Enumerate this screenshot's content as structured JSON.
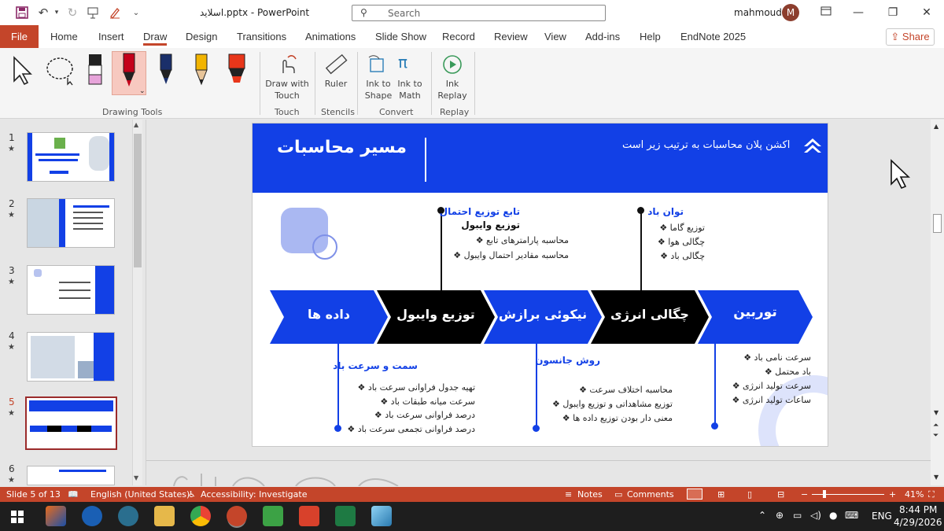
{
  "titlebar": {
    "doc_title": "اسلاید.pptx  -  PowerPoint",
    "search_placeholder": "Search",
    "user_name": "mahmoud",
    "user_initial": "M"
  },
  "tabs": [
    "Home",
    "Insert",
    "Draw",
    "Design",
    "Transitions",
    "Animations",
    "Slide Show",
    "Record",
    "Review",
    "View",
    "Add-ins",
    "Help",
    "EndNote 2025"
  ],
  "file_tab": "File",
  "active_tab": "Draw",
  "share_label": "Share",
  "ribbon": {
    "groups": {
      "drawing_tools": "Drawing Tools",
      "touch": "Touch",
      "stencils": "Stencils",
      "convert": "Convert",
      "replay": "Replay"
    },
    "buttons": {
      "draw_with_touch_1": "Draw with",
      "draw_with_touch_2": "Touch",
      "ruler": "Ruler",
      "ink_to_shape_1": "Ink to",
      "ink_to_shape_2": "Shape",
      "ink_to_math_1": "Ink to",
      "ink_to_math_2": "Math",
      "ink_replay_1": "Ink",
      "ink_replay_2": "Replay"
    }
  },
  "thumbnails": [
    {
      "num": "1",
      "star": "★"
    },
    {
      "num": "2",
      "star": "★"
    },
    {
      "num": "3",
      "star": "★"
    },
    {
      "num": "4",
      "star": "★"
    },
    {
      "num": "5",
      "star": "★"
    },
    {
      "num": "6",
      "star": "★"
    }
  ],
  "slide": {
    "title": "مسیر محاسبات",
    "subtitle": "اکشن پلان محاسبات به ترتیب زیر است",
    "arrows": [
      "توربین",
      "چگالی انرژی",
      "نیکوئی برازش",
      "توزیع وایبول",
      "داده ها"
    ],
    "top_blocks": {
      "wind_power": {
        "heading": "توان باد",
        "items": [
          "توزیع گاما ❖",
          "چگالی هوا ❖",
          "چگالی باد ❖"
        ]
      },
      "prob_dist": {
        "heading": "تابع توزیع احتمال",
        "subheading": "توزیع وایبول",
        "items": [
          "محاسبه پارامترهای تابع ❖",
          "محاسبه مقادیر احتمال وایبول ❖"
        ]
      }
    },
    "bottom_blocks": {
      "wind_dir": {
        "heading": "سمت و سرعت باد",
        "items": [
          "تهیه جدول فراوانی سرعت باد ❖",
          "سرعت میانه طبقات باد ❖",
          "درصد فراوانی سرعت باد ❖",
          "درصد فراوانی تجمعی سرعت باد ❖"
        ]
      },
      "johnson": {
        "heading": "روش جانسون",
        "items": [
          "محاسبه اختلاف سرعت ❖",
          "توزیع مشاهداتی و توزیع وایبول ❖",
          "معنی دار بودن توزیع داده ها ❖"
        ]
      },
      "turbine": {
        "items": [
          "سرعت نامی باد ❖",
          "باد محتمل ❖",
          "سرعت تولید انرژی ❖",
          "ساعات تولید انرژی ❖"
        ]
      }
    }
  },
  "statusbar": {
    "slide_info": "Slide 5 of 13",
    "language": "English (United States)",
    "accessibility": "Accessibility: Investigate",
    "notes": "Notes",
    "comments": "Comments",
    "zoom": "41%"
  },
  "taskbar": {
    "lang": "ENG",
    "time": "8:44 PM",
    "date": "4/29/2026"
  },
  "colors": {
    "accent": "#c4452a",
    "slide_blue": "#1240e6",
    "arrow_black": "#000000"
  }
}
